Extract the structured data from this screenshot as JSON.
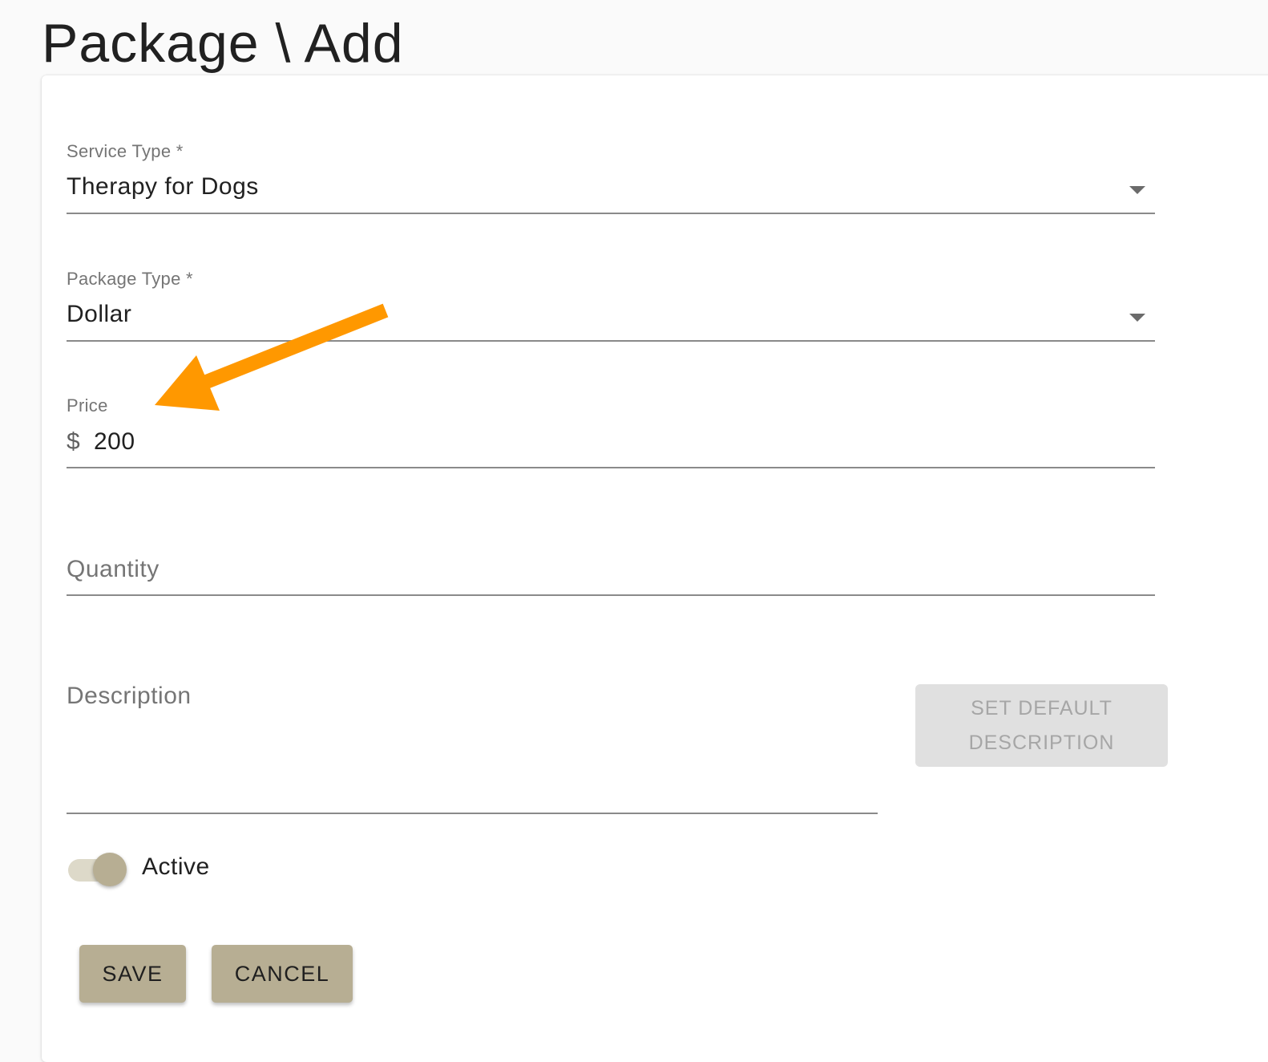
{
  "page": {
    "title": "Package \\ Add"
  },
  "form": {
    "service_type": {
      "label": "Service Type *",
      "value": "Therapy for Dogs"
    },
    "package_type": {
      "label": "Package Type *",
      "value": "Dollar"
    },
    "price": {
      "label": "Price",
      "prefix": "$",
      "value": "200"
    },
    "quantity": {
      "placeholder": "Quantity"
    },
    "description": {
      "placeholder": "Description"
    },
    "set_default_description_label": "SET DEFAULT\nDESCRIPTION",
    "active": {
      "label": "Active",
      "on": true
    },
    "save_label": "SAVE",
    "cancel_label": "CANCEL"
  },
  "annotation": {
    "arrow_color": "#ff9800"
  },
  "colors": {
    "accent": "#b7ae93",
    "accent_light": "#ddd9c9",
    "disabled_button": "#e0e0e0"
  }
}
